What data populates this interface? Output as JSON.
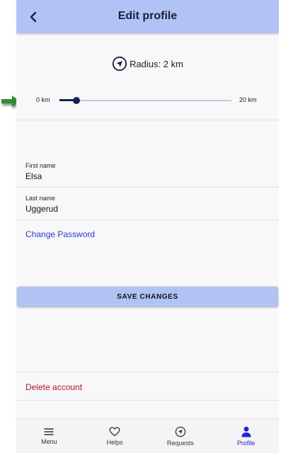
{
  "header": {
    "title": "Edit profile",
    "back_icon": "chevron-left-icon"
  },
  "radius": {
    "label": "Radius: 2 km",
    "icon": "navigation-arrow-icon",
    "min_label": "0 km",
    "max_label": "20 km",
    "min_km": 0,
    "max_km": 20,
    "value_km": 2
  },
  "form": {
    "first_name": {
      "label": "First name",
      "value": "Elsa"
    },
    "last_name": {
      "label": "Last name",
      "value": "Uggerud"
    },
    "change_password": "Change Password",
    "save_button": "SAVE CHANGES",
    "delete_account": "Delete account"
  },
  "bottom_nav": {
    "items": [
      {
        "label": "Menu",
        "icon": "menu-icon"
      },
      {
        "label": "Helps",
        "icon": "heart-icon"
      },
      {
        "label": "Requests",
        "icon": "navigation-arrow-icon"
      },
      {
        "label": "Profile",
        "icon": "person-icon"
      }
    ],
    "active_index": 3
  },
  "colors": {
    "appbar": "#b1c3f4",
    "accent": "#1f26cf",
    "slider": "#1a2150",
    "link": "#2f39d8",
    "danger": "#b0182a",
    "annotation_arrow": "#2e8b2e"
  }
}
